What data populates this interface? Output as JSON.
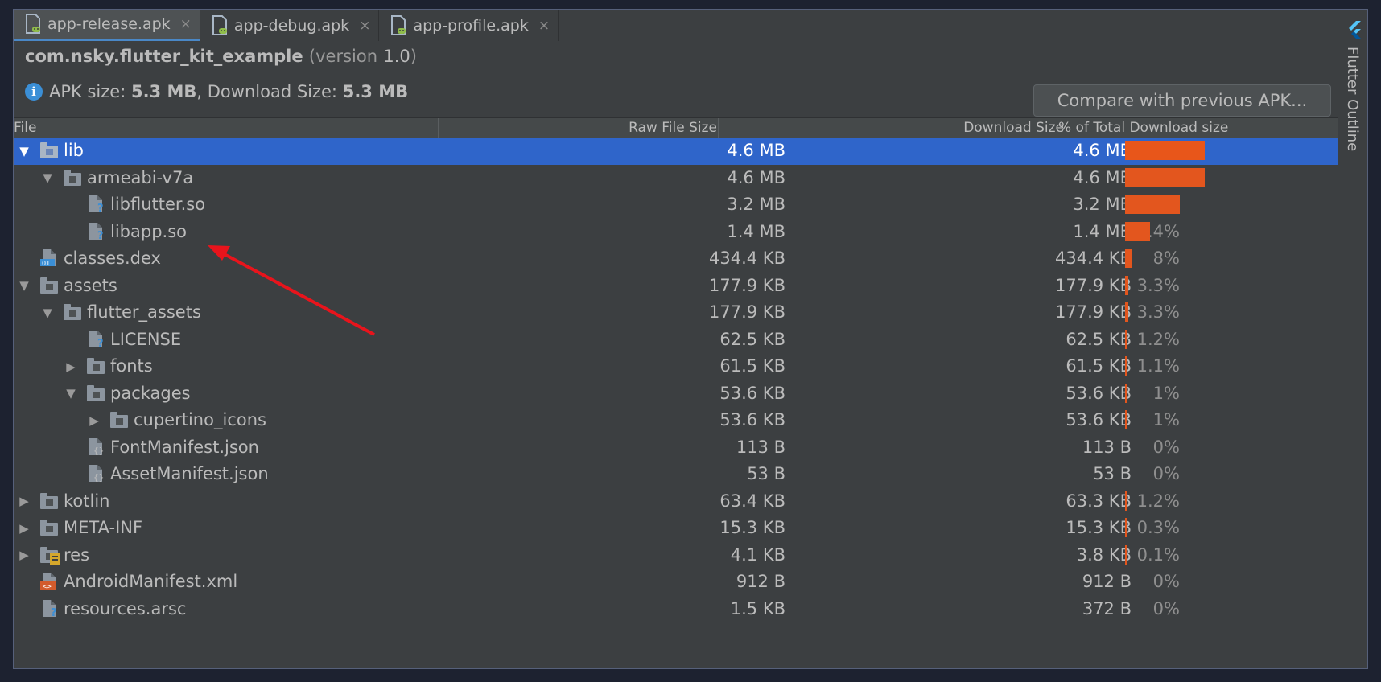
{
  "tabs": [
    {
      "label": "app-release.apk",
      "active": true
    },
    {
      "label": "app-debug.apk",
      "active": false
    },
    {
      "label": "app-profile.apk",
      "active": false
    }
  ],
  "close_glyph": "×",
  "package": {
    "name": "com.nsky.flutter_kit_example",
    "version_open": "(version",
    "version_value": "1.0",
    "version_close": ")"
  },
  "sizes": {
    "apk_label": "APK size:",
    "apk_value": "5.3 MB",
    "separator": ",",
    "download_label": "Download Size:",
    "download_value": "5.3 MB"
  },
  "compare_button": "Compare with previous APK...",
  "side_panel": {
    "label": "Flutter Outline"
  },
  "columns": {
    "file": "File",
    "raw": "Raw File Size",
    "download": "Download Size",
    "percent": "% of Total Download size"
  },
  "rows": [
    {
      "name": "lib",
      "raw": "4.6 MB",
      "download": "4.6 MB",
      "pct": "87.1%",
      "pct_value": 87.1,
      "depth": 0,
      "arrow": "▼",
      "icon": "folder-icon",
      "selected": true
    },
    {
      "name": "armeabi-v7a",
      "raw": "4.6 MB",
      "download": "4.6 MB",
      "pct": "87.1%",
      "pct_value": 87.1,
      "depth": 1,
      "arrow": "▼",
      "icon": "folder-icon"
    },
    {
      "name": "libflutter.so",
      "raw": "3.2 MB",
      "download": "3.2 MB",
      "pct": "59.8%",
      "pct_value": 59.8,
      "depth": 2,
      "arrow": "",
      "icon": "unknown-file-icon"
    },
    {
      "name": "libapp.so",
      "raw": "1.4 MB",
      "download": "1.4 MB",
      "pct": "27.4%",
      "pct_value": 27.4,
      "depth": 2,
      "arrow": "",
      "icon": "unknown-file-icon"
    },
    {
      "name": "classes.dex",
      "raw": "434.4 KB",
      "download": "434.4 KB",
      "pct": "8%",
      "pct_value": 8,
      "depth": 0,
      "arrow": "",
      "icon": "dex-file-icon"
    },
    {
      "name": "assets",
      "raw": "177.9 KB",
      "download": "177.9 KB",
      "pct": "3.3%",
      "pct_value": 3.3,
      "depth": 0,
      "arrow": "▼",
      "icon": "folder-icon"
    },
    {
      "name": "flutter_assets",
      "raw": "177.9 KB",
      "download": "177.9 KB",
      "pct": "3.3%",
      "pct_value": 3.3,
      "depth": 1,
      "arrow": "▼",
      "icon": "folder-icon"
    },
    {
      "name": "LICENSE",
      "raw": "62.5 KB",
      "download": "62.5 KB",
      "pct": "1.2%",
      "pct_value": 1.2,
      "depth": 2,
      "arrow": "",
      "icon": "unknown-file-icon"
    },
    {
      "name": "fonts",
      "raw": "61.5 KB",
      "download": "61.5 KB",
      "pct": "1.1%",
      "pct_value": 1.1,
      "depth": 2,
      "arrow": "▶",
      "icon": "folder-icon"
    },
    {
      "name": "packages",
      "raw": "53.6 KB",
      "download": "53.6 KB",
      "pct": "1%",
      "pct_value": 1,
      "depth": 2,
      "arrow": "▼",
      "icon": "folder-icon"
    },
    {
      "name": "cupertino_icons",
      "raw": "53.6 KB",
      "download": "53.6 KB",
      "pct": "1%",
      "pct_value": 1,
      "depth": 3,
      "arrow": "▶",
      "icon": "folder-icon"
    },
    {
      "name": "FontManifest.json",
      "raw": "113 B",
      "download": "113 B",
      "pct": "0%",
      "pct_value": 0,
      "depth": 2,
      "arrow": "",
      "icon": "json-file-icon"
    },
    {
      "name": "AssetManifest.json",
      "raw": "53 B",
      "download": "53 B",
      "pct": "0%",
      "pct_value": 0,
      "depth": 2,
      "arrow": "",
      "icon": "json-file-icon"
    },
    {
      "name": "kotlin",
      "raw": "63.4 KB",
      "download": "63.3 KB",
      "pct": "1.2%",
      "pct_value": 1.2,
      "depth": 0,
      "arrow": "▶",
      "icon": "folder-icon"
    },
    {
      "name": "META-INF",
      "raw": "15.3 KB",
      "download": "15.3 KB",
      "pct": "0.3%",
      "pct_value": 0.3,
      "depth": 0,
      "arrow": "▶",
      "icon": "folder-icon"
    },
    {
      "name": "res",
      "raw": "4.1 KB",
      "download": "3.8 KB",
      "pct": "0.1%",
      "pct_value": 0.1,
      "depth": 0,
      "arrow": "▶",
      "icon": "res-folder-icon"
    },
    {
      "name": "AndroidManifest.xml",
      "raw": "912 B",
      "download": "912 B",
      "pct": "0%",
      "pct_value": 0,
      "depth": 0,
      "arrow": "",
      "icon": "xml-file-icon"
    },
    {
      "name": "resources.arsc",
      "raw": "1.5 KB",
      "download": "372 B",
      "pct": "0%",
      "pct_value": 0,
      "depth": 0,
      "arrow": "",
      "icon": "unknown-file-icon"
    }
  ],
  "colors": {
    "selection": "#2f65ca",
    "bar": "#e3561e",
    "annotation_arrow": "#e8141c",
    "info_icon": "#3b8fd6"
  }
}
